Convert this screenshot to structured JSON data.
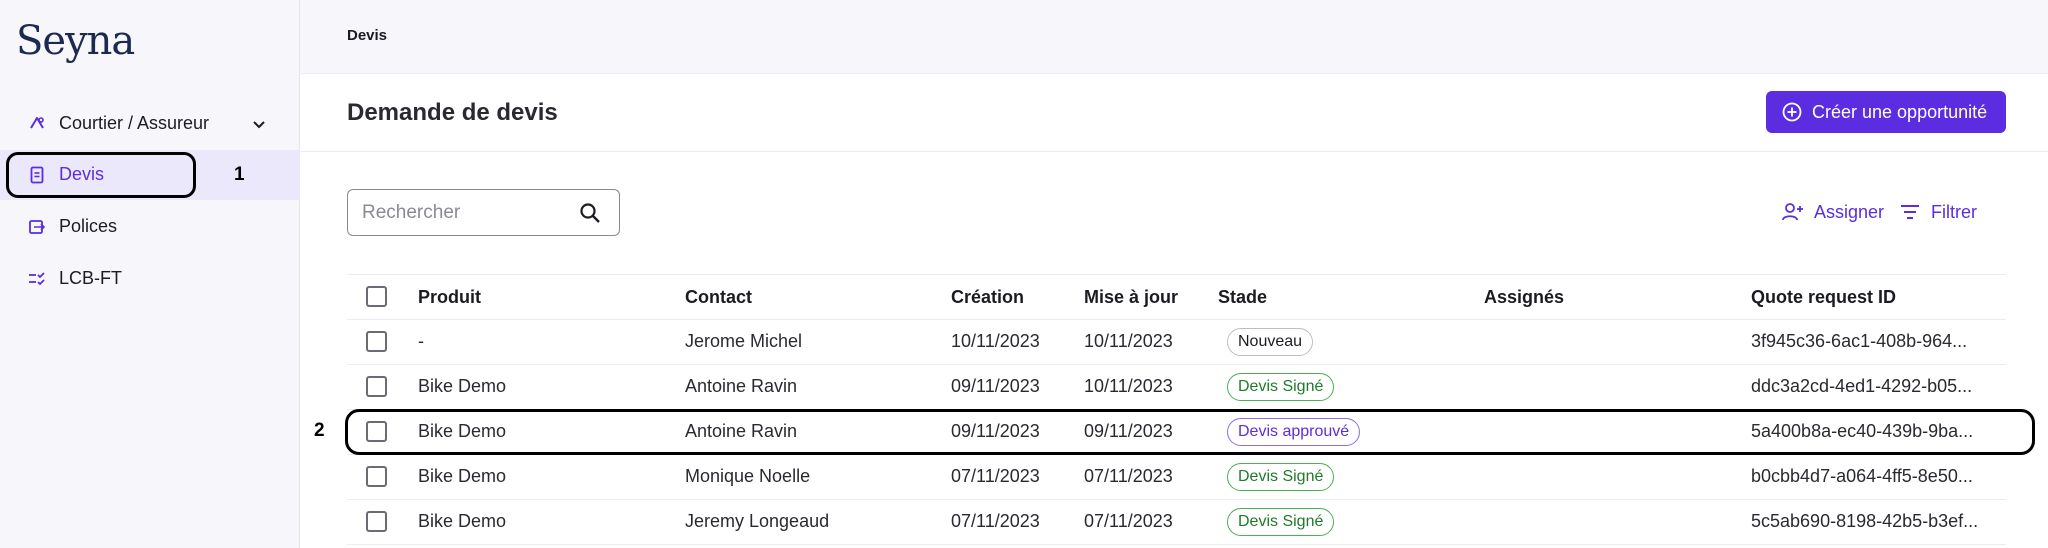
{
  "app": {
    "logo": "Seyna"
  },
  "sidebar": {
    "org_selector": "Courtier / Assureur",
    "items": [
      {
        "label": "Devis",
        "active": true
      },
      {
        "label": "Polices",
        "active": false
      },
      {
        "label": "LCB-FT",
        "active": false
      }
    ]
  },
  "annotations": {
    "first": "1",
    "second": "2"
  },
  "breadcrumb": "Devis",
  "page": {
    "title": "Demande de devis",
    "cta_label": "Créer une opportunité"
  },
  "toolbar": {
    "search_placeholder": "Rechercher",
    "assign_label": "Assigner",
    "filter_label": "Filtrer"
  },
  "table": {
    "columns": [
      "Produit",
      "Contact",
      "Création",
      "Mise à jour",
      "Stade",
      "Assignés",
      "Quote request ID"
    ],
    "rows": [
      {
        "produit": "-",
        "contact": "Jerome Michel",
        "creation": "10/11/2023",
        "maj": "10/11/2023",
        "stade": "Nouveau",
        "stade_kind": "neutral",
        "assignes": "",
        "id": "3f945c36-6ac1-408b-964..."
      },
      {
        "produit": "Bike Demo",
        "contact": "Antoine Ravin",
        "creation": "09/11/2023",
        "maj": "10/11/2023",
        "stade": "Devis Signé",
        "stade_kind": "signed",
        "assignes": "",
        "id": "ddc3a2cd-4ed1-4292-b05..."
      },
      {
        "produit": "Bike Demo",
        "contact": "Antoine Ravin",
        "creation": "09/11/2023",
        "maj": "09/11/2023",
        "stade": "Devis approuvé",
        "stade_kind": "approved",
        "assignes": "",
        "id": "5a400b8a-ec40-439b-9ba..."
      },
      {
        "produit": "Bike Demo",
        "contact": "Monique Noelle",
        "creation": "07/11/2023",
        "maj": "07/11/2023",
        "stade": "Devis Signé",
        "stade_kind": "signed",
        "assignes": "",
        "id": "b0cbb4d7-a064-4ff5-8e50..."
      },
      {
        "produit": "Bike Demo",
        "contact": "Jeremy Longeaud",
        "creation": "07/11/2023",
        "maj": "07/11/2023",
        "stade": "Devis Signé",
        "stade_kind": "signed",
        "assignes": "",
        "id": "5c5ab690-8198-42b5-b3ef..."
      }
    ]
  },
  "colors": {
    "accent": "#5b2ce0",
    "active_bg": "#ece8fc",
    "signed": "#1e7a2a"
  }
}
